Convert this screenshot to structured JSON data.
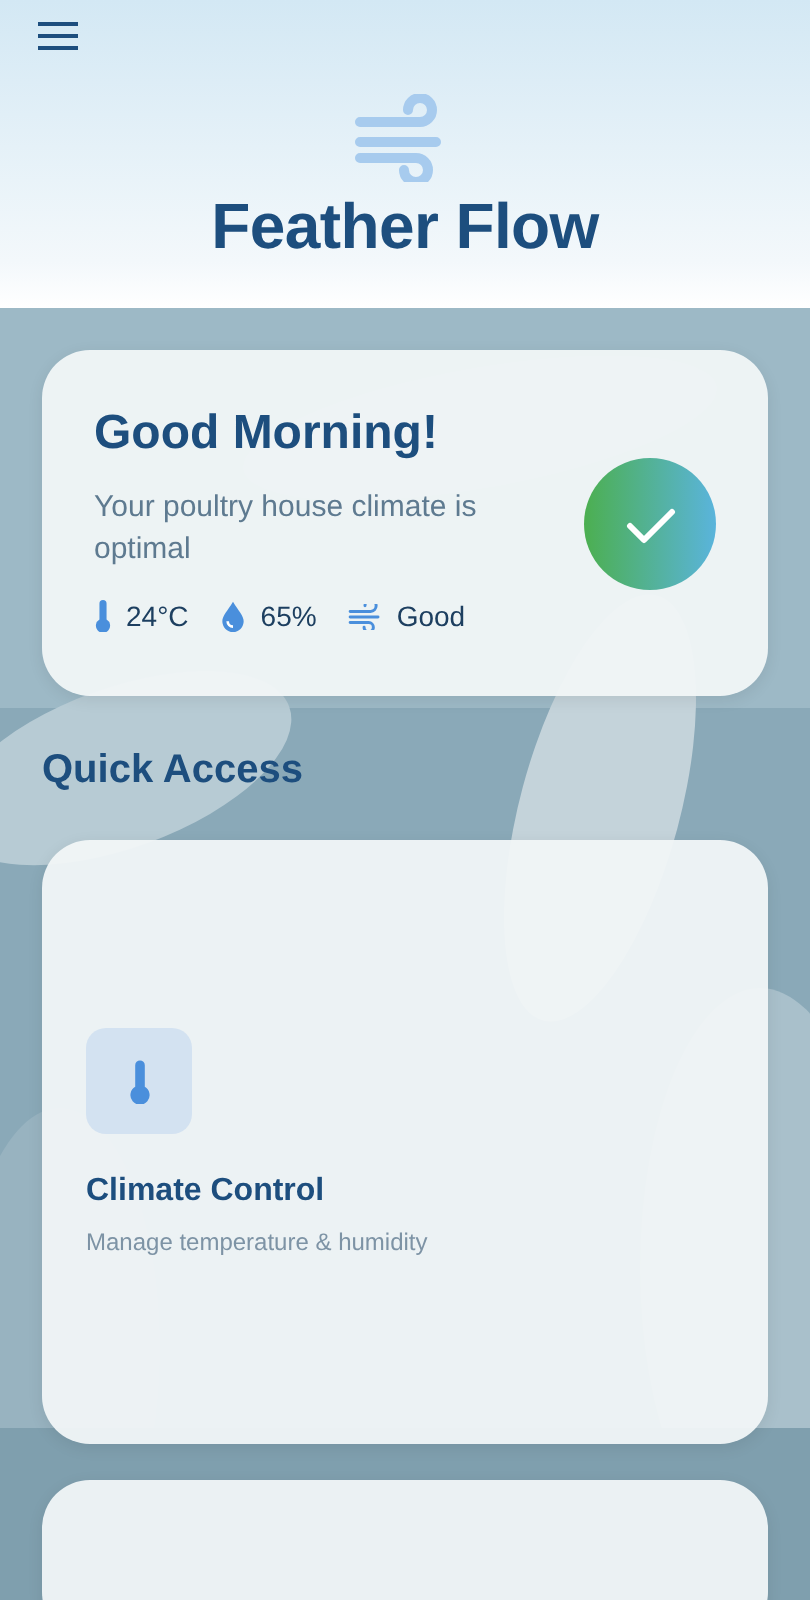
{
  "app": {
    "title": "Feather Flow"
  },
  "status_card": {
    "greeting": "Good Morning!",
    "message": "Your poultry house climate is optimal",
    "optimal": true,
    "stats": [
      {
        "kind": "temperature",
        "value": "24°C"
      },
      {
        "kind": "humidity",
        "value": "65%"
      },
      {
        "kind": "air",
        "value": "Good"
      }
    ]
  },
  "quick_access": {
    "heading": "Quick Access",
    "items": [
      {
        "kind": "climate",
        "title": "Climate Control",
        "description": "Manage temperature & humidity"
      }
    ]
  }
}
